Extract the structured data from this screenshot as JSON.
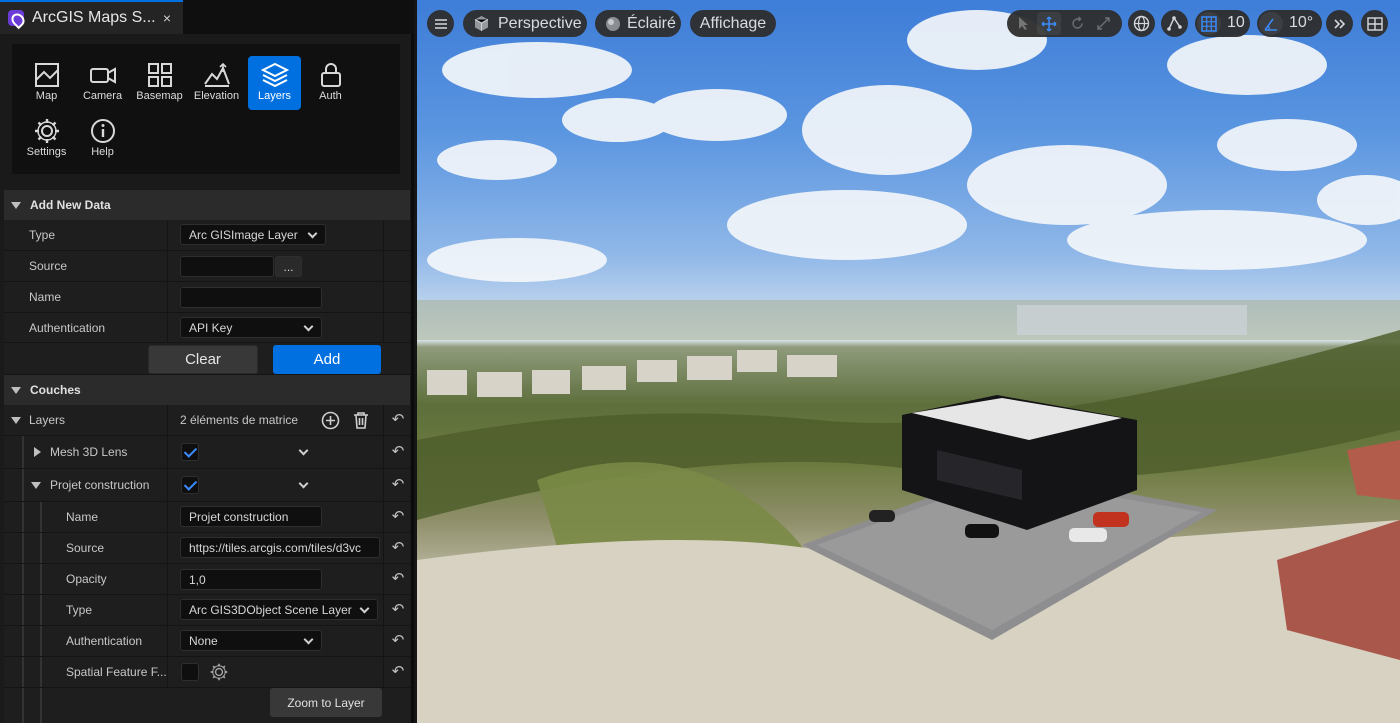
{
  "tab": {
    "title": "ArcGIS Maps S...",
    "close": "×"
  },
  "tools": [
    {
      "label": "Map",
      "icon": "map-icon"
    },
    {
      "label": "Camera",
      "icon": "camera-icon"
    },
    {
      "label": "Basemap",
      "icon": "basemap-icon"
    },
    {
      "label": "Elevation",
      "icon": "elevation-icon"
    },
    {
      "label": "Layers",
      "icon": "layers-icon",
      "active": true
    },
    {
      "label": "Auth",
      "icon": "lock-icon"
    },
    {
      "label": "Settings",
      "icon": "gear-icon"
    },
    {
      "label": "Help",
      "icon": "help-icon"
    }
  ],
  "add_new_data": {
    "header": "Add New Data",
    "type_label": "Type",
    "type_value": "Arc GISImage Layer",
    "source_label": "Source",
    "source_value": "",
    "browse": "...",
    "name_label": "Name",
    "name_value": "",
    "auth_label": "Authentication",
    "auth_value": "API Key",
    "clear": "Clear",
    "add": "Add"
  },
  "couches": {
    "header": "Couches",
    "layers_label": "Layers",
    "layers_count": "2 éléments de matrice",
    "items": [
      {
        "name": "Mesh 3D Lens",
        "visible": true
      },
      {
        "name": "Projet construction",
        "visible": true
      }
    ],
    "props": {
      "name_label": "Name",
      "name_value": "Projet construction",
      "source_label": "Source",
      "source_value": "https://tiles.arcgis.com/tiles/d3vc",
      "opacity_label": "Opacity",
      "opacity_value": "1,0",
      "type_label": "Type",
      "type_value": "Arc GIS3DObject Scene Layer",
      "auth_label": "Authentication",
      "auth_value": "None",
      "spatial_label": "Spatial Feature F..."
    },
    "zoom": "Zoom to Layer"
  },
  "viewport": {
    "perspective": "Perspective",
    "lit": "Éclairé",
    "show": "Affichage",
    "grid_value": "10",
    "angle_value": "10°"
  },
  "colors": {
    "accent": "#0070e0",
    "panel": "#1e1e1e",
    "header": "#2b2b2b"
  }
}
